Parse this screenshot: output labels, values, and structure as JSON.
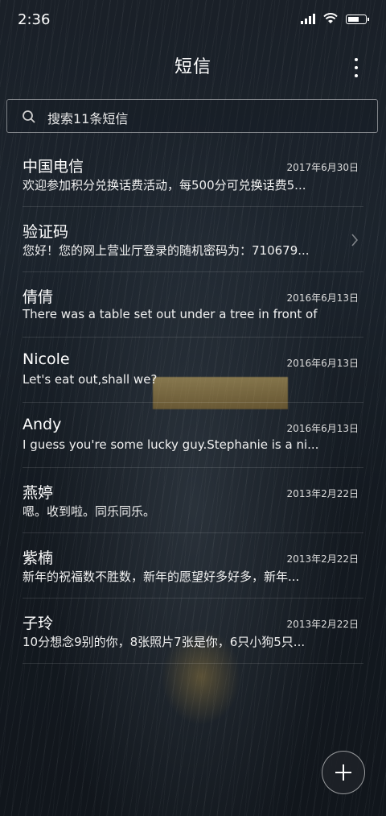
{
  "status_bar": {
    "time": "2:36"
  },
  "header": {
    "title": "短信"
  },
  "search": {
    "placeholder": "搜索11条短信"
  },
  "messages": [
    {
      "name": "中国电信",
      "date": "2017年6月30日",
      "preview": "欢迎参加积分兑换话费活动，每500分可兑换话费5..."
    },
    {
      "name": "验证码",
      "date": "",
      "preview": "您好！您的网上营业厅登录的随机密码为：710679..."
    },
    {
      "name": "倩倩",
      "date": "2016年6月13日",
      "preview": "There was a table set out under a tree in front of ..."
    },
    {
      "name": "Nicole",
      "date": "2016年6月13日",
      "preview": "Let's eat out,shall we?"
    },
    {
      "name": "Andy",
      "date": "2016年6月13日",
      "preview": "I guess you're some lucky guy.Stephanie is a ni..."
    },
    {
      "name": "燕婷",
      "date": "2013年2月22日",
      "preview": "嗯。收到啦。同乐同乐。"
    },
    {
      "name": "紫楠",
      "date": "2013年2月22日",
      "preview": "新年的祝福数不胜数，新年的愿望好多好多，新年..."
    },
    {
      "name": "子玲",
      "date": "2013年2月22日",
      "preview": "10分想念9别的你，8张照片7张是你，6只小狗5只..."
    }
  ],
  "icons": {
    "search": "search-icon",
    "more": "more-vertical-icon",
    "compose": "plus-icon",
    "chevron": "chevron-right-icon"
  }
}
